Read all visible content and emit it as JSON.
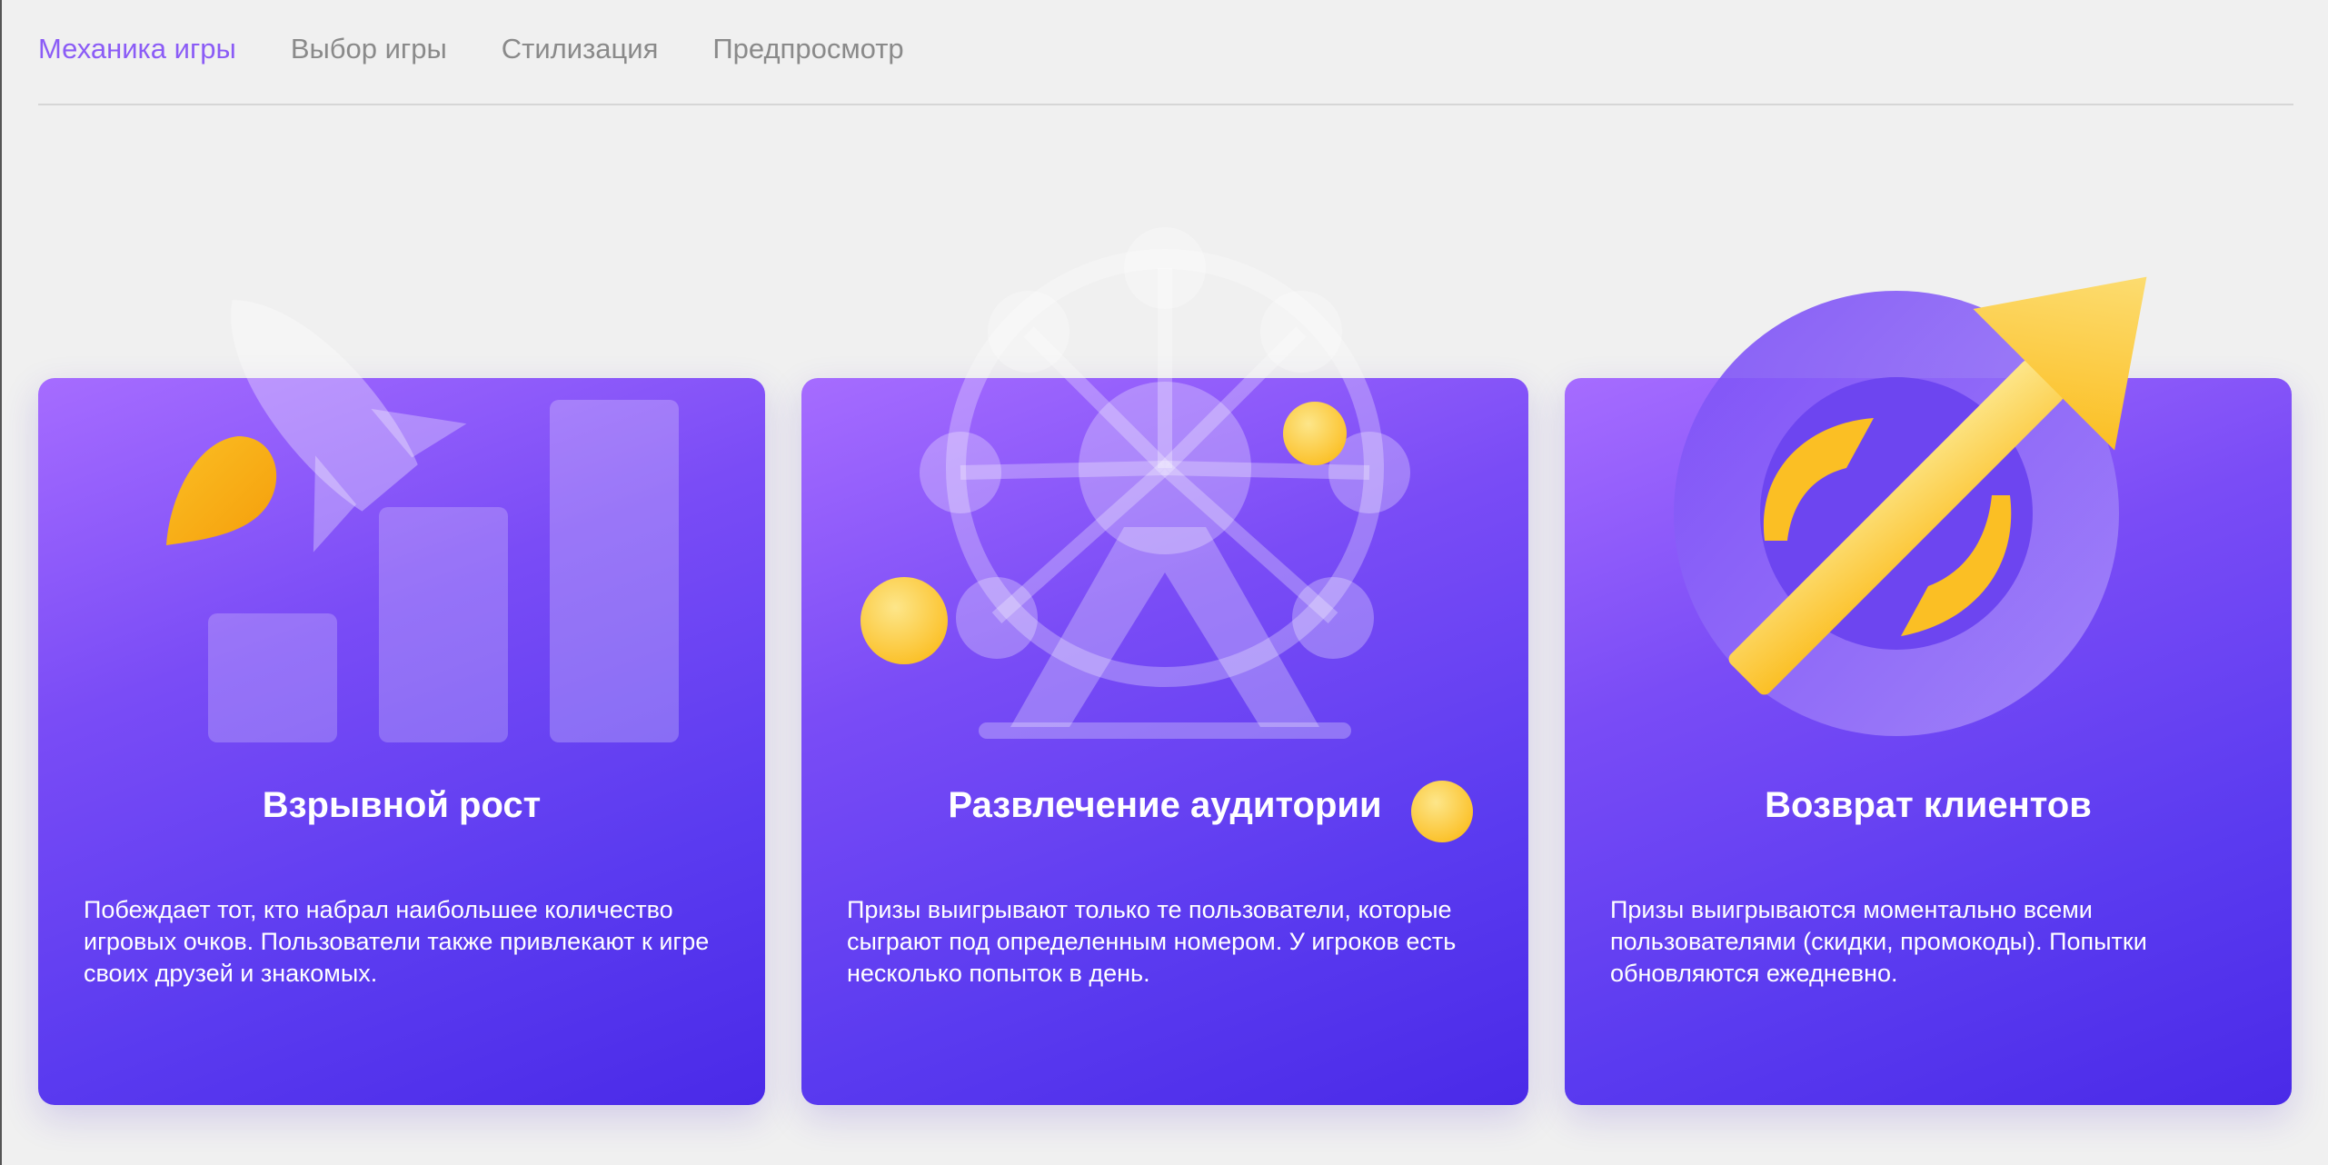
{
  "tabs": [
    {
      "label": "Механика игры",
      "active": true
    },
    {
      "label": "Выбор игры",
      "active": false
    },
    {
      "label": "Стилизация",
      "active": false
    },
    {
      "label": "Предпросмотр",
      "active": false
    }
  ],
  "cards": [
    {
      "title": "Взрывной рост",
      "description": "Побеждает тот, кто набрал наибольшее количество игровых очков. Пользователи также привлекают к игре своих друзей и знакомых.",
      "icon": "rocket-growth-icon"
    },
    {
      "title": "Развлечение аудитории",
      "description": "Призы выигрывают только те пользователи, которые сыграют под определенным номером. У игроков есть несколько попыток в день.",
      "icon": "ferris-wheel-icon"
    },
    {
      "title": "Возврат клиентов",
      "description": "Призы выигрываются моментально всеми пользователями (скидки, промокоды). Попытки обновляются ежедневно.",
      "icon": "return-arrow-icon"
    }
  ],
  "colors": {
    "accent": "#8b5cf6",
    "tab_inactive": "#8a8a8a",
    "card_gradient_start": "#a66cff",
    "card_gradient_end": "#4a2ae8",
    "gold": "#fcd34d"
  }
}
